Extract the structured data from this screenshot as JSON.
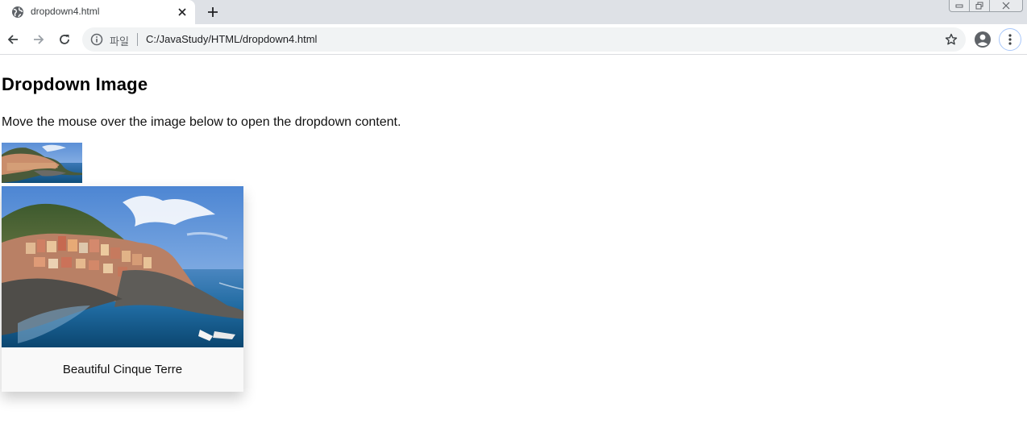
{
  "browser": {
    "tab": {
      "title": "dropdown4.html",
      "favicon_icon": "globe-icon",
      "close_icon": "close-icon"
    },
    "new_tab_icon": "plus-icon",
    "window_controls": [
      "minimize-icon",
      "restore-icon",
      "close-icon"
    ],
    "toolbar": {
      "back_icon": "arrow-left-icon",
      "forward_icon": "arrow-right-icon",
      "reload_icon": "reload-icon",
      "info_icon": "info-icon",
      "scheme_label": "파일",
      "url": "C:/JavaStudy/HTML/dropdown4.html",
      "star_icon": "star-icon",
      "profile_icon": "account-circle-icon",
      "menu_icon": "kebab-menu-icon"
    }
  },
  "page": {
    "heading": "Dropdown Image",
    "description": "Move the mouse over the image below to open the dropdown content.",
    "thumbnail_image": "cinque-terre-coastal-village-photo",
    "dropdown": {
      "image": "cinque-terre-coastal-village-photo",
      "caption": "Beautiful Cinque Terre"
    }
  },
  "colors": {
    "tabstrip_bg": "#dee1e6",
    "omnibox_bg": "#f1f3f4",
    "dropdown_bg": "#f9f9f9",
    "focus_ring": "#a8c7fa"
  }
}
